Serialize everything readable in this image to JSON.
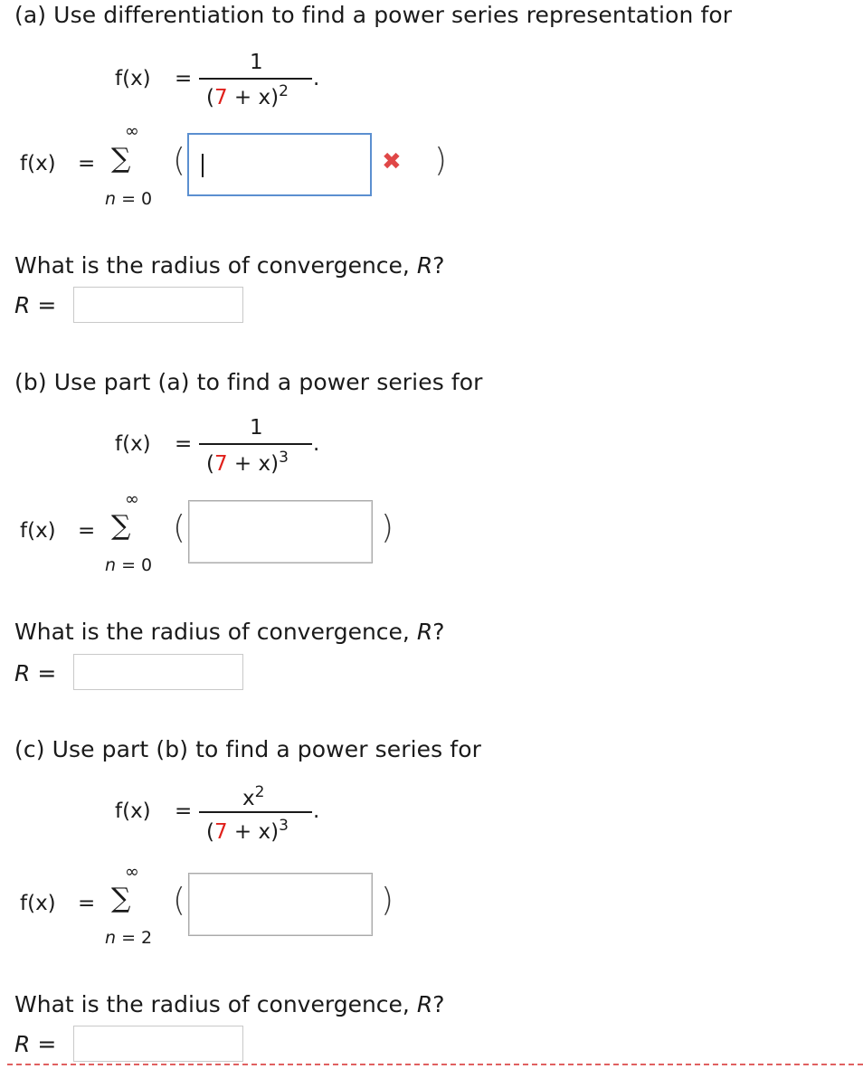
{
  "part_a": {
    "heading": "(a) Use differentiation to find a power series representation for",
    "lhs": "f(x)",
    "eq": "=",
    "numerator": "1",
    "den_open": "(",
    "den_seven": "7",
    "den_rest": " + x)",
    "den_exp": "2",
    "period": ".",
    "series_lhs": "f(x)",
    "series_eq": "=",
    "sigma": "∑",
    "upper": "∞",
    "lower": "n = 0",
    "lower_var": "n",
    "lower_rest": " = 0",
    "open_paren": "(",
    "close_paren": ")",
    "series_value": "",
    "status_icon": "x-mark-icon",
    "status_color": "#e04747",
    "radius_question": "What is the radius of convergence, ",
    "radius_var": "R",
    "radius_q": "?",
    "r_label_var": "R",
    "r_label_eq": " =",
    "r_value": ""
  },
  "part_b": {
    "heading": "(b) Use part (a) to find a power series for",
    "lhs": "f(x)",
    "eq": "=",
    "numerator": "1",
    "den_open": "(",
    "den_seven": "7",
    "den_rest": " + x)",
    "den_exp": "3",
    "period": ".",
    "series_lhs": "f(x)",
    "series_eq": "=",
    "sigma": "∑",
    "upper": "∞",
    "lower_var": "n",
    "lower_rest": " = 0",
    "open_paren": "(",
    "close_paren": ")",
    "series_value": "",
    "radius_question": "What is the radius of convergence, ",
    "radius_var": "R",
    "radius_q": "?",
    "r_label_var": "R",
    "r_label_eq": " =",
    "r_value": ""
  },
  "part_c": {
    "heading": "(c) Use part (b) to find a power series for",
    "lhs": "f(x)",
    "eq": "=",
    "numerator": "x",
    "num_exp": "2",
    "den_open": "(",
    "den_seven": "7",
    "den_rest": " + x)",
    "den_exp": "3",
    "period": ".",
    "series_lhs": "f(x)",
    "series_eq": "=",
    "sigma": "∑",
    "upper": "∞",
    "lower_var": "n",
    "lower_rest": " = 2",
    "open_paren": "(",
    "close_paren": ")",
    "series_value": "",
    "radius_question": "What is the radius of convergence, ",
    "radius_var": "R",
    "radius_q": "?",
    "r_label_var": "R",
    "r_label_eq": " =",
    "r_value": ""
  },
  "colors": {
    "highlight_seven": "#e0201b",
    "focus_border": "#5b8fd0",
    "bottom_dash": "#e06060"
  }
}
